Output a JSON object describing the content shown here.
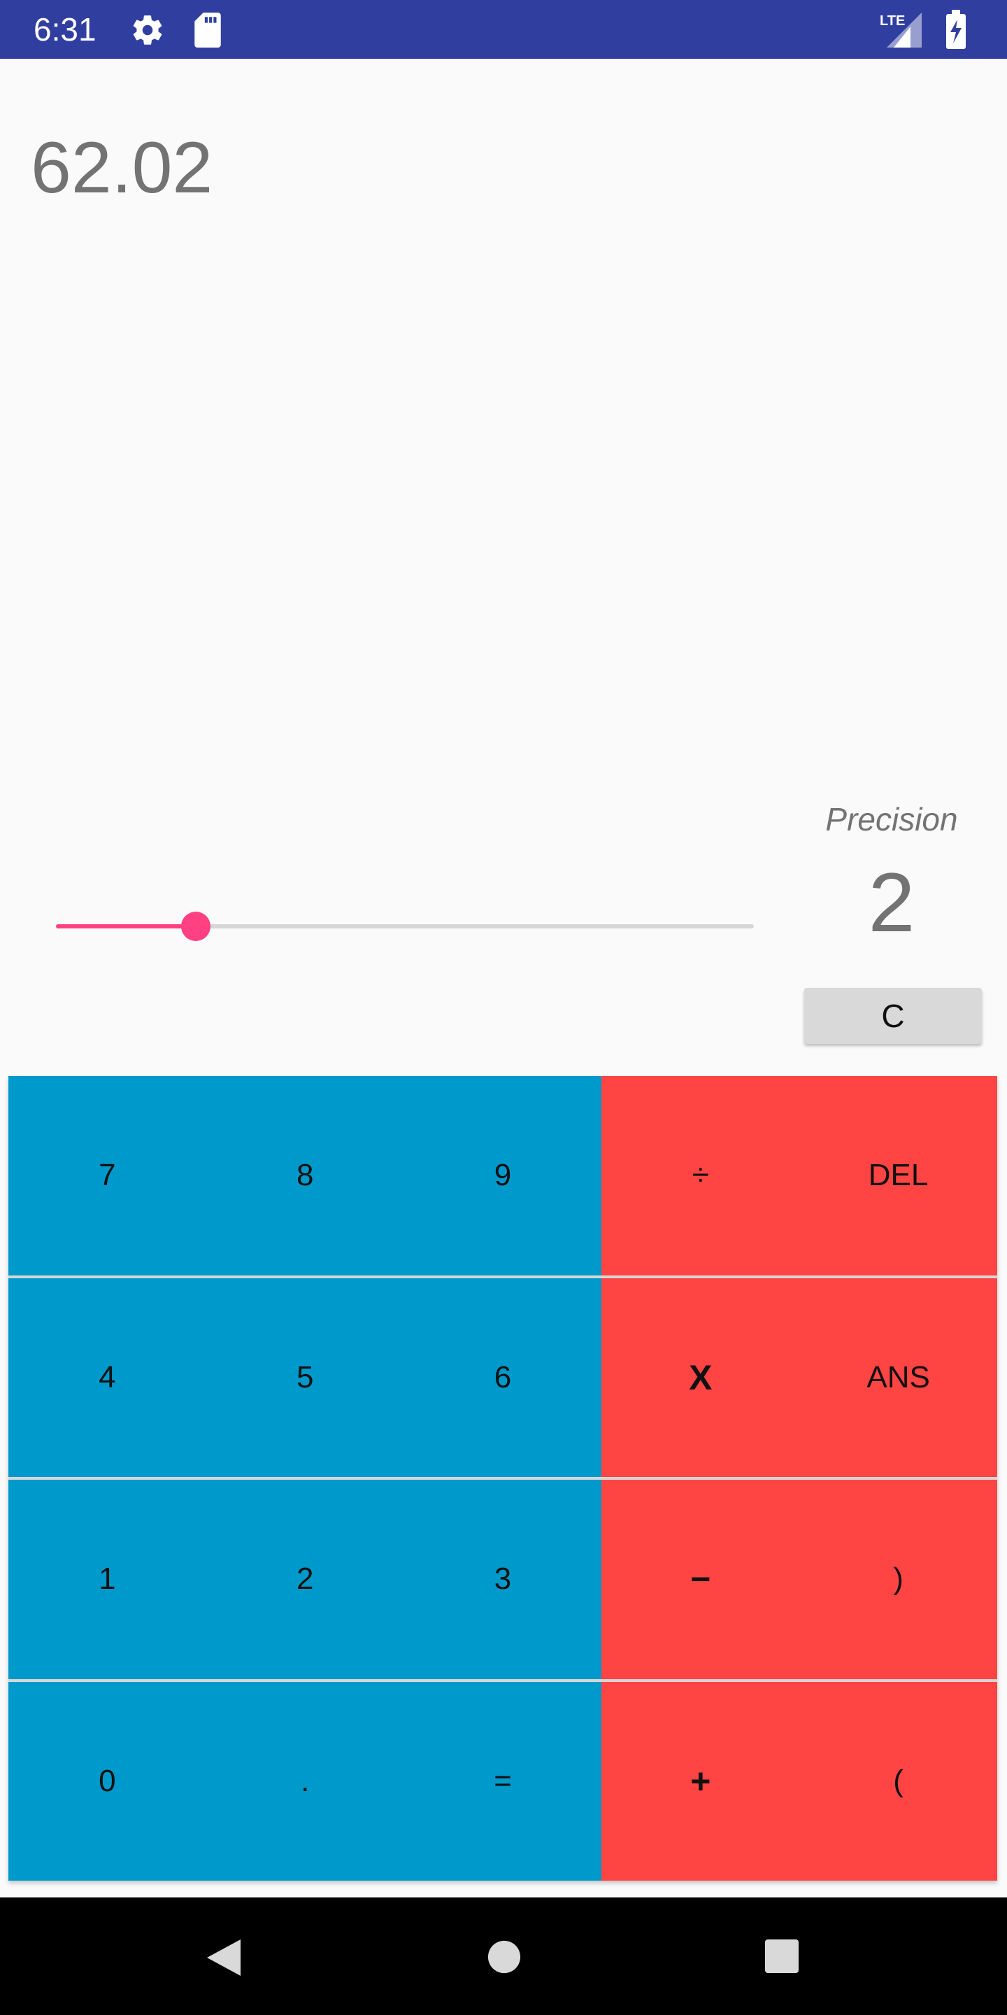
{
  "status_bar": {
    "time": "6:31",
    "icons": [
      "gear-icon",
      "sd-card-icon",
      "lte-signal-icon",
      "battery-charging-icon"
    ],
    "network_label": "LTE",
    "color": "#303f9f"
  },
  "display": {
    "value": "62.02"
  },
  "precision": {
    "label": "Precision",
    "value": "2",
    "slider_fraction": 0.2,
    "accent_color": "#ff4081"
  },
  "clear_button": {
    "label": "C"
  },
  "keypad": {
    "number_color": "#0099cc",
    "operator_color": "#ff4444",
    "keys": [
      {
        "label": "7",
        "type": "num"
      },
      {
        "label": "8",
        "type": "num"
      },
      {
        "label": "9",
        "type": "num"
      },
      {
        "label": "÷",
        "type": "op"
      },
      {
        "label": "DEL",
        "type": "op"
      },
      {
        "label": "4",
        "type": "num"
      },
      {
        "label": "5",
        "type": "num"
      },
      {
        "label": "6",
        "type": "num"
      },
      {
        "label": "X",
        "type": "op"
      },
      {
        "label": "ANS",
        "type": "op"
      },
      {
        "label": "1",
        "type": "num"
      },
      {
        "label": "2",
        "type": "num"
      },
      {
        "label": "3",
        "type": "num"
      },
      {
        "label": "−",
        "type": "op"
      },
      {
        "label": ")",
        "type": "op"
      },
      {
        "label": "0",
        "type": "num"
      },
      {
        "label": ".",
        "type": "num"
      },
      {
        "label": "=",
        "type": "num"
      },
      {
        "label": "+",
        "type": "op"
      },
      {
        "label": "(",
        "type": "op"
      }
    ]
  },
  "nav_bar": {
    "icons": [
      "back-icon",
      "home-icon",
      "recents-icon"
    ]
  }
}
